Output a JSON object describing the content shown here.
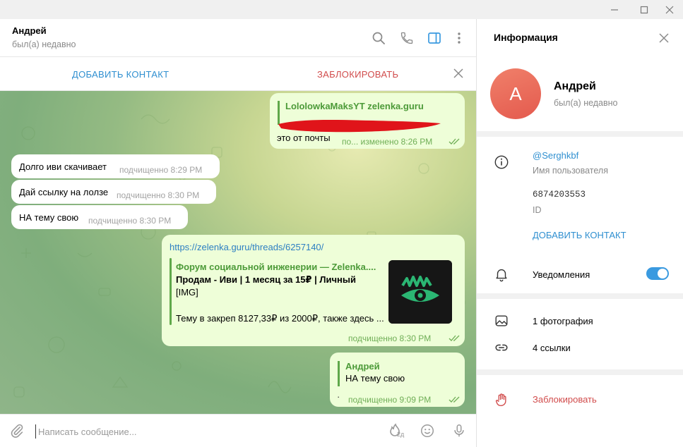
{
  "chat": {
    "peer_name": "Андрей",
    "peer_status": "был(а) недавно",
    "add_contact": "ДОБАВИТЬ КОНТАКТ",
    "block": "ЗАБЛОКИРОВАТЬ"
  },
  "messages": [
    {
      "dir": "out",
      "quote_title": "LololowkaMaksYT zelenka.guru",
      "text": "это от почты",
      "meta": "по... изменено 8:26 PM"
    },
    {
      "dir": "in",
      "text": "Долго иви скачивает",
      "meta": "подчищенно 8:29 PM"
    },
    {
      "dir": "in",
      "text": "Дай ссылку на лолзе",
      "meta": "подчищенно 8:30 PM"
    },
    {
      "dir": "in",
      "text": "НА тему свою",
      "meta": "подчищенно 8:30 PM"
    },
    {
      "dir": "out",
      "link": "https://zelenka.guru/threads/6257140/",
      "preview_title": "Форум социальной инженерии — Zelenka....",
      "preview_line1": "Продам - Иви | 1 месяц за 15₽ | Личный",
      "preview_line2": "[IMG]",
      "preview_line3": "Тему в закреп 8127,33₽ из 2000₽, также здесь ...",
      "meta": "подчищенно 8:30 PM"
    },
    {
      "dir": "out",
      "quote_title": "Андрей",
      "quote_text": "НА тему свою",
      "text": "·",
      "meta": "подчищенно 9:09 PM"
    }
  ],
  "composer": {
    "placeholder": "Написать сообщение...",
    "sticker_badge": "2д"
  },
  "info": {
    "title": "Информация",
    "name": "Андрей",
    "status": "был(а) недавно",
    "avatar_letter": "A",
    "username": "@Serghkbf",
    "username_label": "Имя пользователя",
    "id": "6874203553",
    "id_label": "ID",
    "add_contact": "ДОБАВИТЬ КОНТАКТ",
    "notifications": "Уведомления",
    "notifications_on": true,
    "photos": "1 фотография",
    "links": "4 ссылки",
    "block": "Заблокировать"
  },
  "colors": {
    "accent": "#2f8fd0",
    "danger": "#d14c4c",
    "outgoing_bubble": "#eefed8",
    "reply_green": "#4c9a38",
    "toggle_on": "#3a9ae0"
  }
}
